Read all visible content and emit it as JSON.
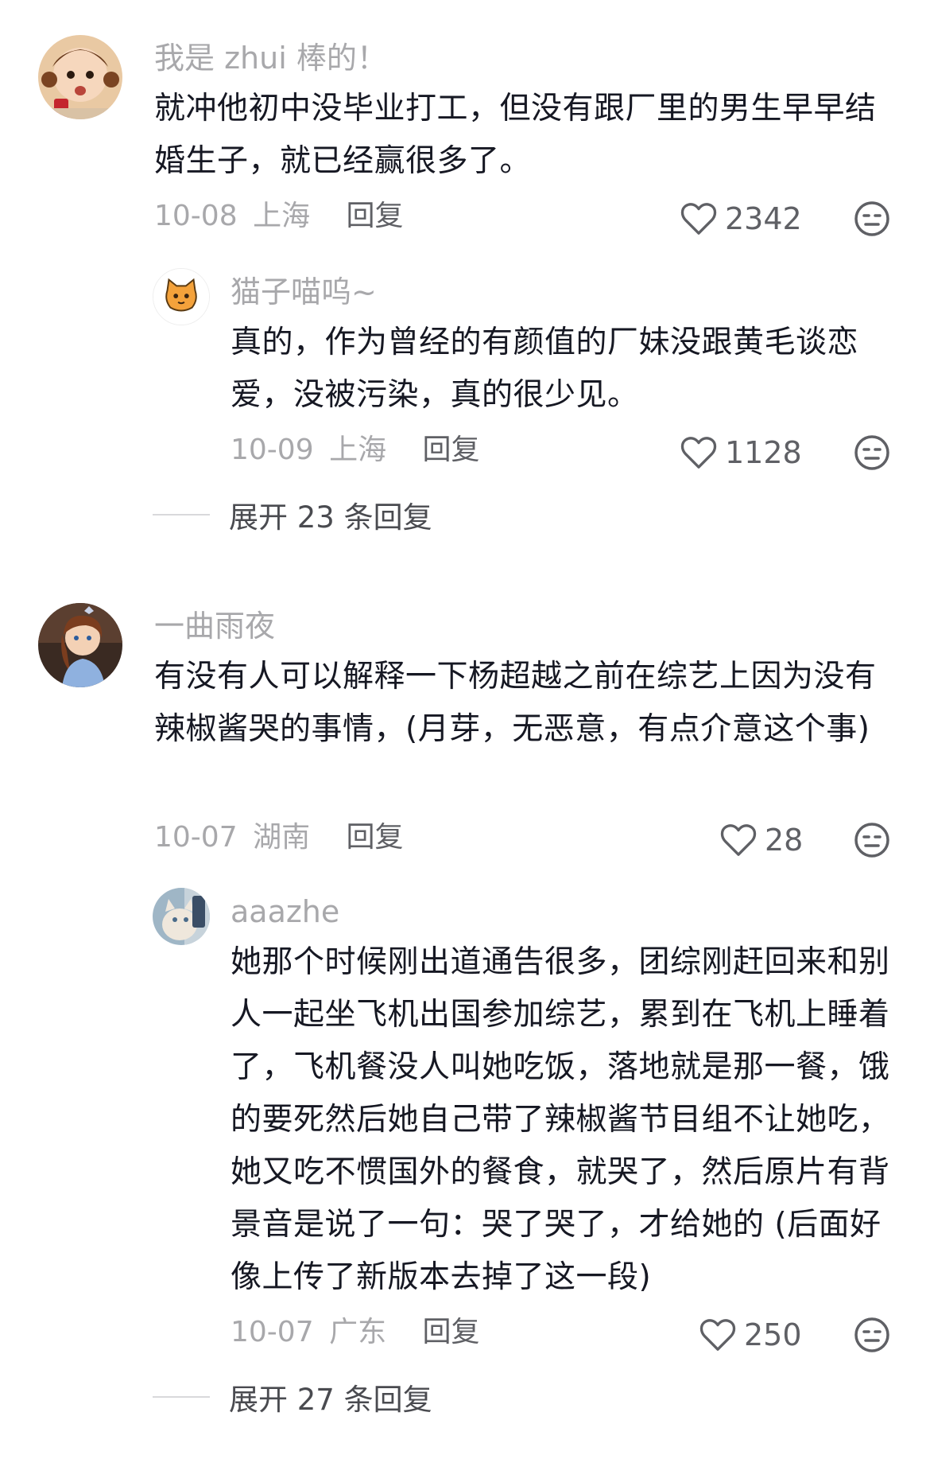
{
  "comments": [
    {
      "username": "我是 zhui 棒的！",
      "text": "就冲他初中没毕业打工，但没有跟厂里的男生早早结婚生子，就已经赢很多了。",
      "date": "10-08",
      "location": "上海",
      "reply_label": "回复",
      "likes": "2342",
      "reply": {
        "username": "猫子喵呜~",
        "text": "真的，作为曾经的有颜值的厂妹没跟黄毛谈恋爱，没被污染，真的很少见。",
        "date": "10-09",
        "location": "上海",
        "reply_label": "回复",
        "likes": "1128"
      },
      "expand_label": "展开 23 条回复"
    },
    {
      "username": "一曲雨夜",
      "text": "有没有人可以解释一下杨超越之前在综艺上因为没有辣椒酱哭的事情，(月芽，无恶意，有点介意这个事)",
      "date": "10-07",
      "location": "湖南",
      "reply_label": "回复",
      "likes": "28",
      "reply": {
        "username": "aaazhe",
        "text": "她那个时候刚出道通告很多，团综刚赶回来和别人一起坐飞机出国参加综艺，累到在飞机上睡着了，飞机餐没人叫她吃饭，落地就是那一餐，饿的要死然后她自己带了辣椒酱节目组不让她吃，她又吃不惯国外的餐食，就哭了，然后原片有背景音是说了一句：哭了哭了，才给她的 (后面好像上传了新版本去掉了这一段)",
        "date": "10-07",
        "location": "广东",
        "reply_label": "回复",
        "likes": "250"
      },
      "expand_label": "展开 27 条回复"
    }
  ],
  "icons": {
    "like": "heart-outline-icon",
    "dislike": "meh-face-icon"
  },
  "colors": {
    "username": "#a8a8ab",
    "text": "#161823",
    "meta": "#a8a8ab"
  }
}
